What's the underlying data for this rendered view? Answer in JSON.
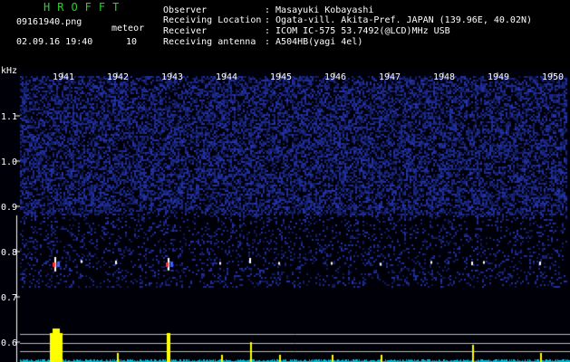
{
  "header": {
    "logo": "HROFFT",
    "filename": "09161940.png",
    "meteor_label": "meteor",
    "datetime": "02.09.16 19:40",
    "meteor_count": "10",
    "observer_label": "Observer",
    "observer_value": ": Masayuki Kobayashi",
    "location_label": "Receiving Location",
    "location_value": ": Ogata-vill. Akita-Pref. JAPAN (139.96E, 40.02N)",
    "receiver_label": "Receiver",
    "receiver_value": ": ICOM IC-575 53.7492(@LCD)MHz USB",
    "antenna_label": "Receiving antenna",
    "antenna_value": ": A504HB(yagi 4el)"
  },
  "spectrogram": {
    "y_unit": "kHz",
    "y_ticks": [
      "1.1",
      "1.0",
      "0.9",
      "0.8",
      "0.7",
      "0.6"
    ],
    "x_ticks": [
      "1941",
      "1942",
      "1943",
      "1944",
      "1945",
      "1946",
      "1947",
      "1948",
      "1949",
      "1950"
    ],
    "colors": {
      "background": "#000000",
      "noise": "#2a3aa0",
      "signal": "#ffffff",
      "echo": "#ff3030",
      "profile": "#ffff00"
    }
  }
}
